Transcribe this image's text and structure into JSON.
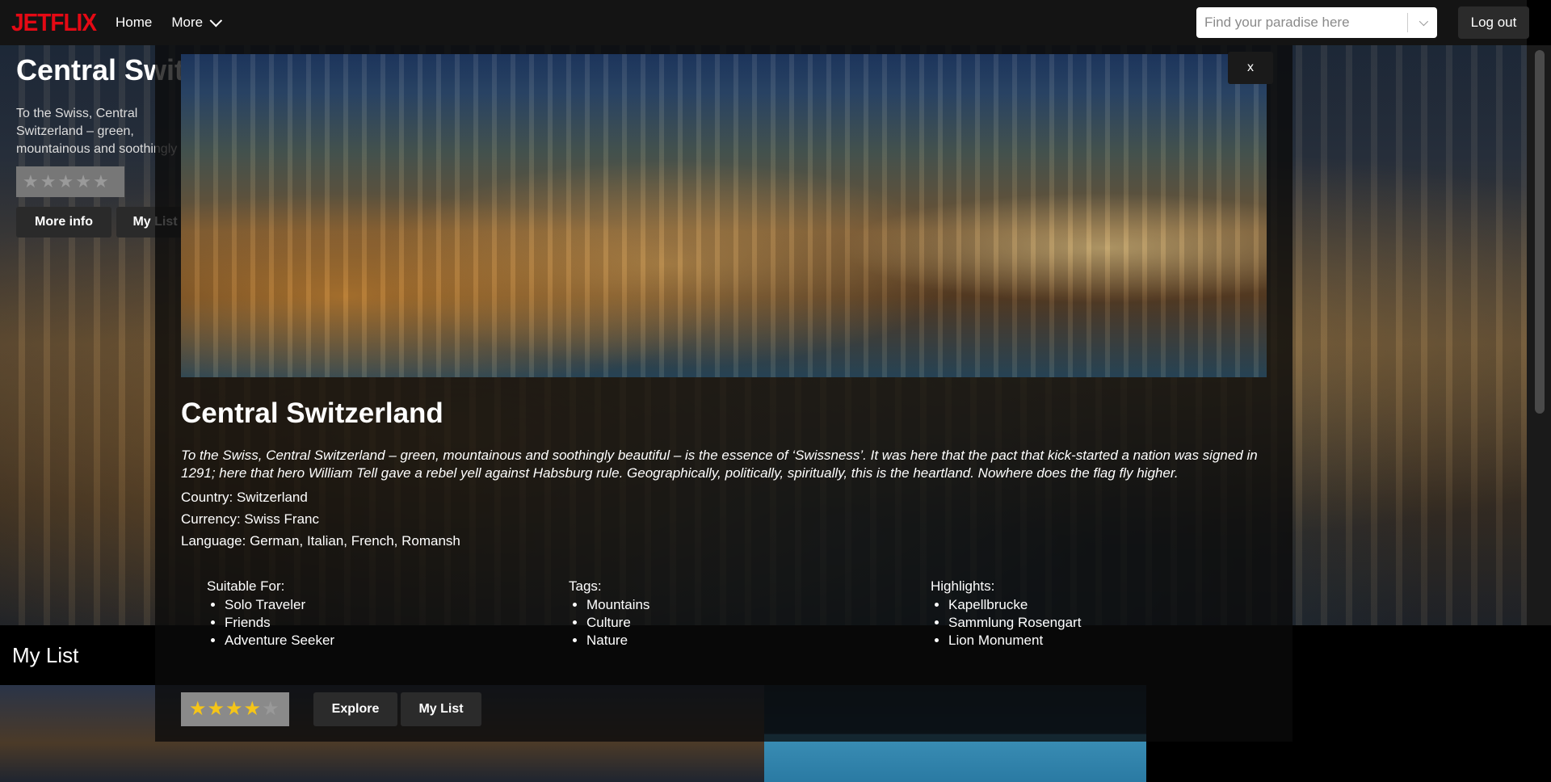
{
  "header": {
    "logo": "JETFLIX",
    "home": "Home",
    "more": "More",
    "search_placeholder": "Find your paradise here",
    "logout": "Log out"
  },
  "hero": {
    "title": "Central Switzerland",
    "description": "To the Swiss, Central Switzerland – green, mountainous and soothingly beautiful – is the essence of 'Swissness'. It was here that the pact that kick-started a nation was signed in 1291; here that hero William Tell gave a rebel yell against Habsburg rule. Geographically, politically, spiritually, this is the heartland.",
    "rating": 0,
    "more_info": "More info",
    "my_list": "My List"
  },
  "my_list_section": {
    "title": "My List"
  },
  "modal": {
    "close": "x",
    "title": "Central Switzerland",
    "description": "To the Swiss, Central Switzerland – green, mountainous and soothingly beautiful – is the essence of ‘Swissness’. It was here that the pact that kick-started a nation was signed in 1291; here that hero William Tell gave a rebel yell against Habsburg rule. Geographically, politically, spiritually, this is the heartland. Nowhere does the flag fly higher.",
    "country": "Country: Switzerland",
    "currency": "Currency: Swiss Franc",
    "language": "Language: German, Italian, French, Romansh",
    "suitable_label": "Suitable For:",
    "suitable": [
      "Solo Traveler",
      "Friends",
      "Adventure Seeker"
    ],
    "tags_label": "Tags:",
    "tags": [
      "Mountains",
      "Culture",
      "Nature"
    ],
    "highlights_label": "Highlights:",
    "highlights": [
      "Kapellbrucke",
      "Sammlung Rosengart",
      "Lion Monument"
    ],
    "rating": 4,
    "rating_max": 5,
    "explore": "Explore",
    "my_list": "My List"
  },
  "colors": {
    "brand": "#e50914",
    "star_on": "#f5c518",
    "star_off": "#9a9a9a"
  }
}
